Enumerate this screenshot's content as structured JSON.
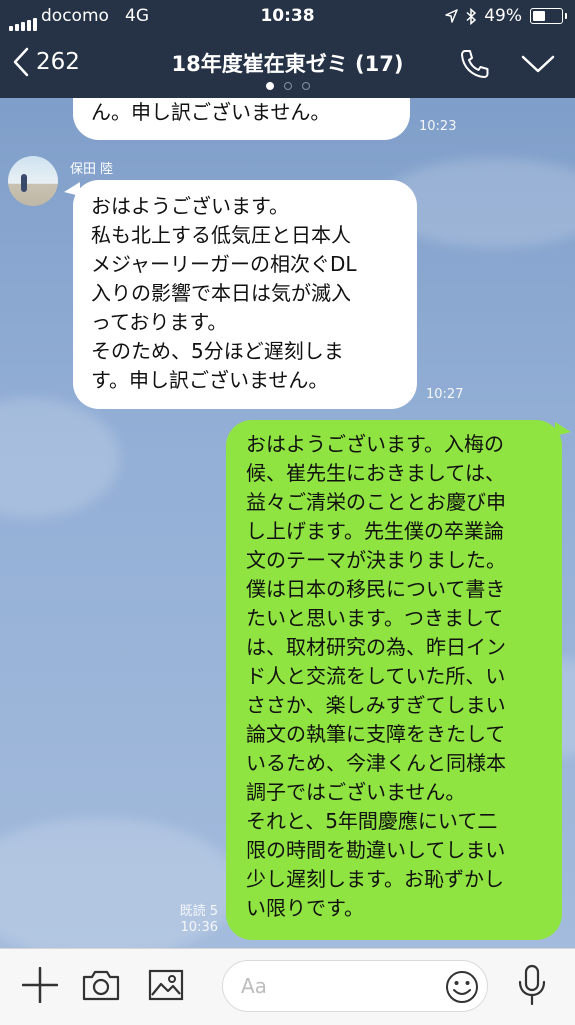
{
  "status_bar": {
    "carrier": "docomo",
    "network": "4G",
    "time": "10:38",
    "battery": "49%"
  },
  "header": {
    "back_count": "262",
    "title": "18年度崔在東ゼミ (17)"
  },
  "messages": [
    {
      "type": "incoming",
      "text": "ん。申し訳ございません。",
      "time": "10:23"
    },
    {
      "type": "incoming",
      "sender": "保田 陸",
      "lines": [
        "おはようございます。",
        "私も北上する低気圧と日本人",
        "メジャーリーガーの相次ぐDL",
        "入りの影響で本日は気が滅入",
        "っております。",
        "そのため、5分ほど遅刻しま",
        "す。申し訳ございません。"
      ],
      "time": "10:27"
    },
    {
      "type": "outgoing",
      "lines": [
        "おはようございます。入梅の",
        "候、崔先生におきましては、",
        "益々ご清栄のこととお慶び申",
        "し上げます。先生僕の卒業論",
        "文のテーマが決まりました。",
        "僕は日本の移民について書き",
        "たいと思います。つきまして",
        "は、取材研究の為、昨日イン",
        "ド人と交流をしていた所、い",
        "ささか、楽しみすぎてしまい",
        "論文の執筆に支障をきたして",
        "いるため、今津くんと同様本",
        "調子ではございません。",
        "それと、5年間慶應にいて二",
        "限の時間を勘違いしてしまい",
        "少し遅刻します。お恥ずかし",
        "い限りです。"
      ],
      "read": "既読 5",
      "time": "10:36"
    }
  ],
  "input": {
    "placeholder": "Aa"
  },
  "icons": [
    "back-chevron-icon",
    "phone-icon",
    "chevron-down-icon",
    "plus-icon",
    "camera-icon",
    "image-icon",
    "smile-icon",
    "mic-icon"
  ],
  "colors": {
    "header_bg": "#263246",
    "outgoing_bubble": "#8fe441",
    "incoming_bubble": "#ffffff",
    "chat_bg": "#8fa9cf"
  }
}
